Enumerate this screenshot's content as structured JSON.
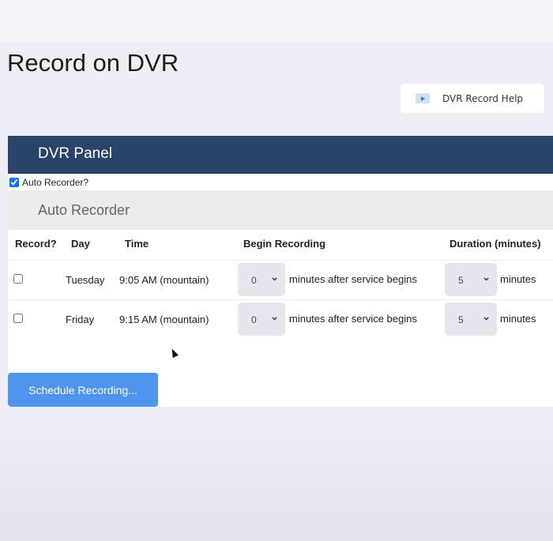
{
  "page": {
    "title": "Record on DVR",
    "help_button": "DVR Record Help"
  },
  "panel": {
    "title": "DVR Panel",
    "auto_checkbox_label": "Auto Recorder?",
    "auto_checked": true,
    "section_title": "Auto Recorder"
  },
  "table": {
    "headers": [
      "Record?",
      "Day",
      "Time",
      "Begin Recording",
      "Duration (minutes)"
    ],
    "rows": [
      {
        "record": false,
        "day": "Tuesday",
        "time": "9:05 AM (mountain)",
        "begin": "0",
        "begin_suffix": "minutes after service begins",
        "duration": "5",
        "duration_suffix": "minutes"
      },
      {
        "record": false,
        "day": "Friday",
        "time": "9:15 AM (mountain)",
        "begin": "0",
        "begin_suffix": "minutes after service begins",
        "duration": "5",
        "duration_suffix": "minutes"
      }
    ]
  },
  "actions": {
    "schedule": "Schedule Recording..."
  },
  "colors": {
    "header": "#2c4369",
    "button": "#4f95f0"
  }
}
